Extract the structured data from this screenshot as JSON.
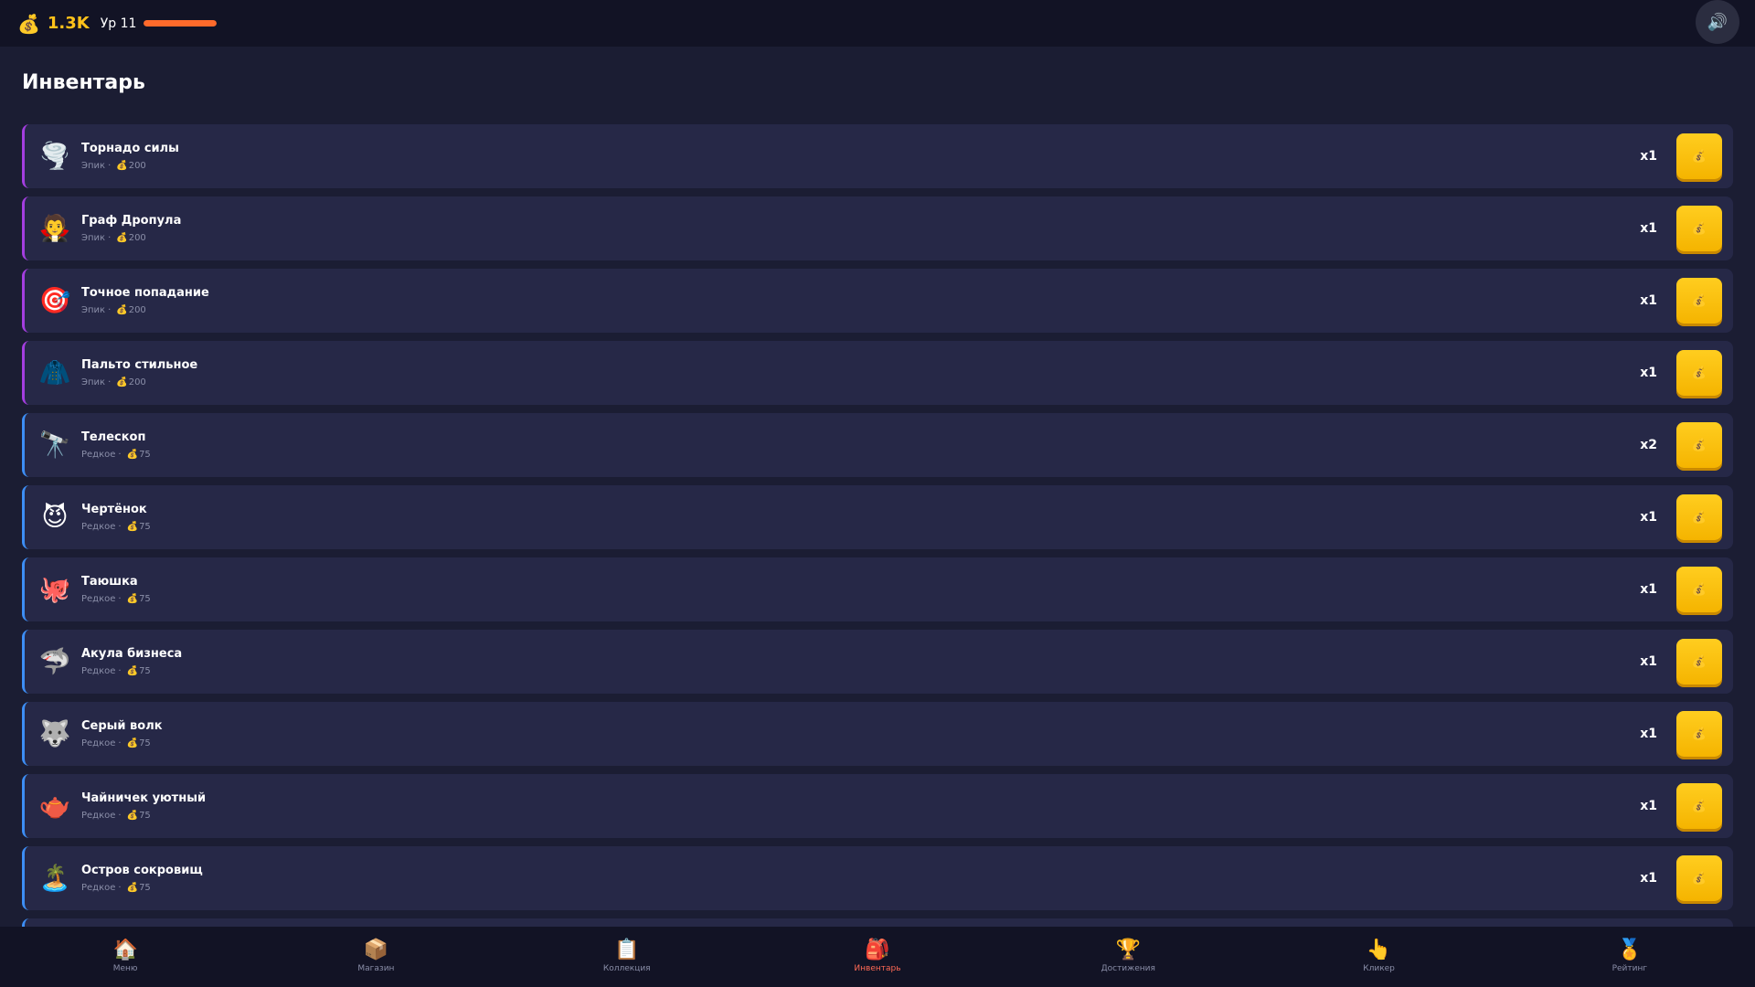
{
  "header": {
    "coin_icon": "💰",
    "balance": "1.3K",
    "level_label": "Ур 11",
    "xp_progress": 1.0,
    "sound_icon": "🔊"
  },
  "page": {
    "title": "Инвентарь"
  },
  "colors": {
    "epic_border": "#a43ee0",
    "rare_border": "#3d8ef5",
    "sell_button": "#ffc21a",
    "balance_text": "#ffc21a",
    "xp_bar": "#ff6a2b",
    "active_nav": "#ff6a55"
  },
  "inventory": {
    "items": [
      {
        "icon": "🌪️",
        "name": "Торнадо силы",
        "rarity": "Эпик",
        "sep": "·",
        "coin": "💰",
        "price": "200",
        "qty": "x1",
        "sell_icon": "💰"
      },
      {
        "icon": "🧛",
        "name": "Граф Дропула",
        "rarity": "Эпик",
        "sep": "·",
        "coin": "💰",
        "price": "200",
        "qty": "x1",
        "sell_icon": "💰"
      },
      {
        "icon": "🎯",
        "name": "Точное попадание",
        "rarity": "Эпик",
        "sep": "·",
        "coin": "💰",
        "price": "200",
        "qty": "x1",
        "sell_icon": "💰"
      },
      {
        "icon": "🧥",
        "name": "Пальто стильное",
        "rarity": "Эпик",
        "sep": "·",
        "coin": "💰",
        "price": "200",
        "qty": "x1",
        "sell_icon": "💰"
      },
      {
        "icon": "🔭",
        "name": "Телескоп",
        "rarity": "Редкое",
        "sep": "·",
        "coin": "💰",
        "price": "75",
        "qty": "x2",
        "sell_icon": "💰"
      },
      {
        "icon": "😈",
        "name": "Чертёнок",
        "rarity": "Редкое",
        "sep": "·",
        "coin": "💰",
        "price": "75",
        "qty": "x1",
        "sell_icon": "💰"
      },
      {
        "icon": "🐙",
        "name": "Таюшка",
        "rarity": "Редкое",
        "sep": "·",
        "coin": "💰",
        "price": "75",
        "qty": "x1",
        "sell_icon": "💰"
      },
      {
        "icon": "🦈",
        "name": "Акула бизнеса",
        "rarity": "Редкое",
        "sep": "·",
        "coin": "💰",
        "price": "75",
        "qty": "x1",
        "sell_icon": "💰"
      },
      {
        "icon": "🐺",
        "name": "Серый волк",
        "rarity": "Редкое",
        "sep": "·",
        "coin": "💰",
        "price": "75",
        "qty": "x1",
        "sell_icon": "💰"
      },
      {
        "icon": "🫖",
        "name": "Чайничек уютный",
        "rarity": "Редкое",
        "sep": "·",
        "coin": "💰",
        "price": "75",
        "qty": "x1",
        "sell_icon": "💰"
      },
      {
        "icon": "🏝️",
        "name": "Остров сокровищ",
        "rarity": "Редкое",
        "sep": "·",
        "coin": "💰",
        "price": "75",
        "qty": "x1",
        "sell_icon": "💰"
      }
    ]
  },
  "nav": {
    "items": [
      {
        "icon": "🏠",
        "label": "Меню"
      },
      {
        "icon": "📦",
        "label": "Магазин"
      },
      {
        "icon": "📋",
        "label": "Коллекция"
      },
      {
        "icon": "🎒",
        "label": "Инвентарь",
        "active": true
      },
      {
        "icon": "🏆",
        "label": "Достижения"
      },
      {
        "icon": "👆",
        "label": "Кликер"
      },
      {
        "icon": "🏅",
        "label": "Рейтинг"
      }
    ]
  }
}
